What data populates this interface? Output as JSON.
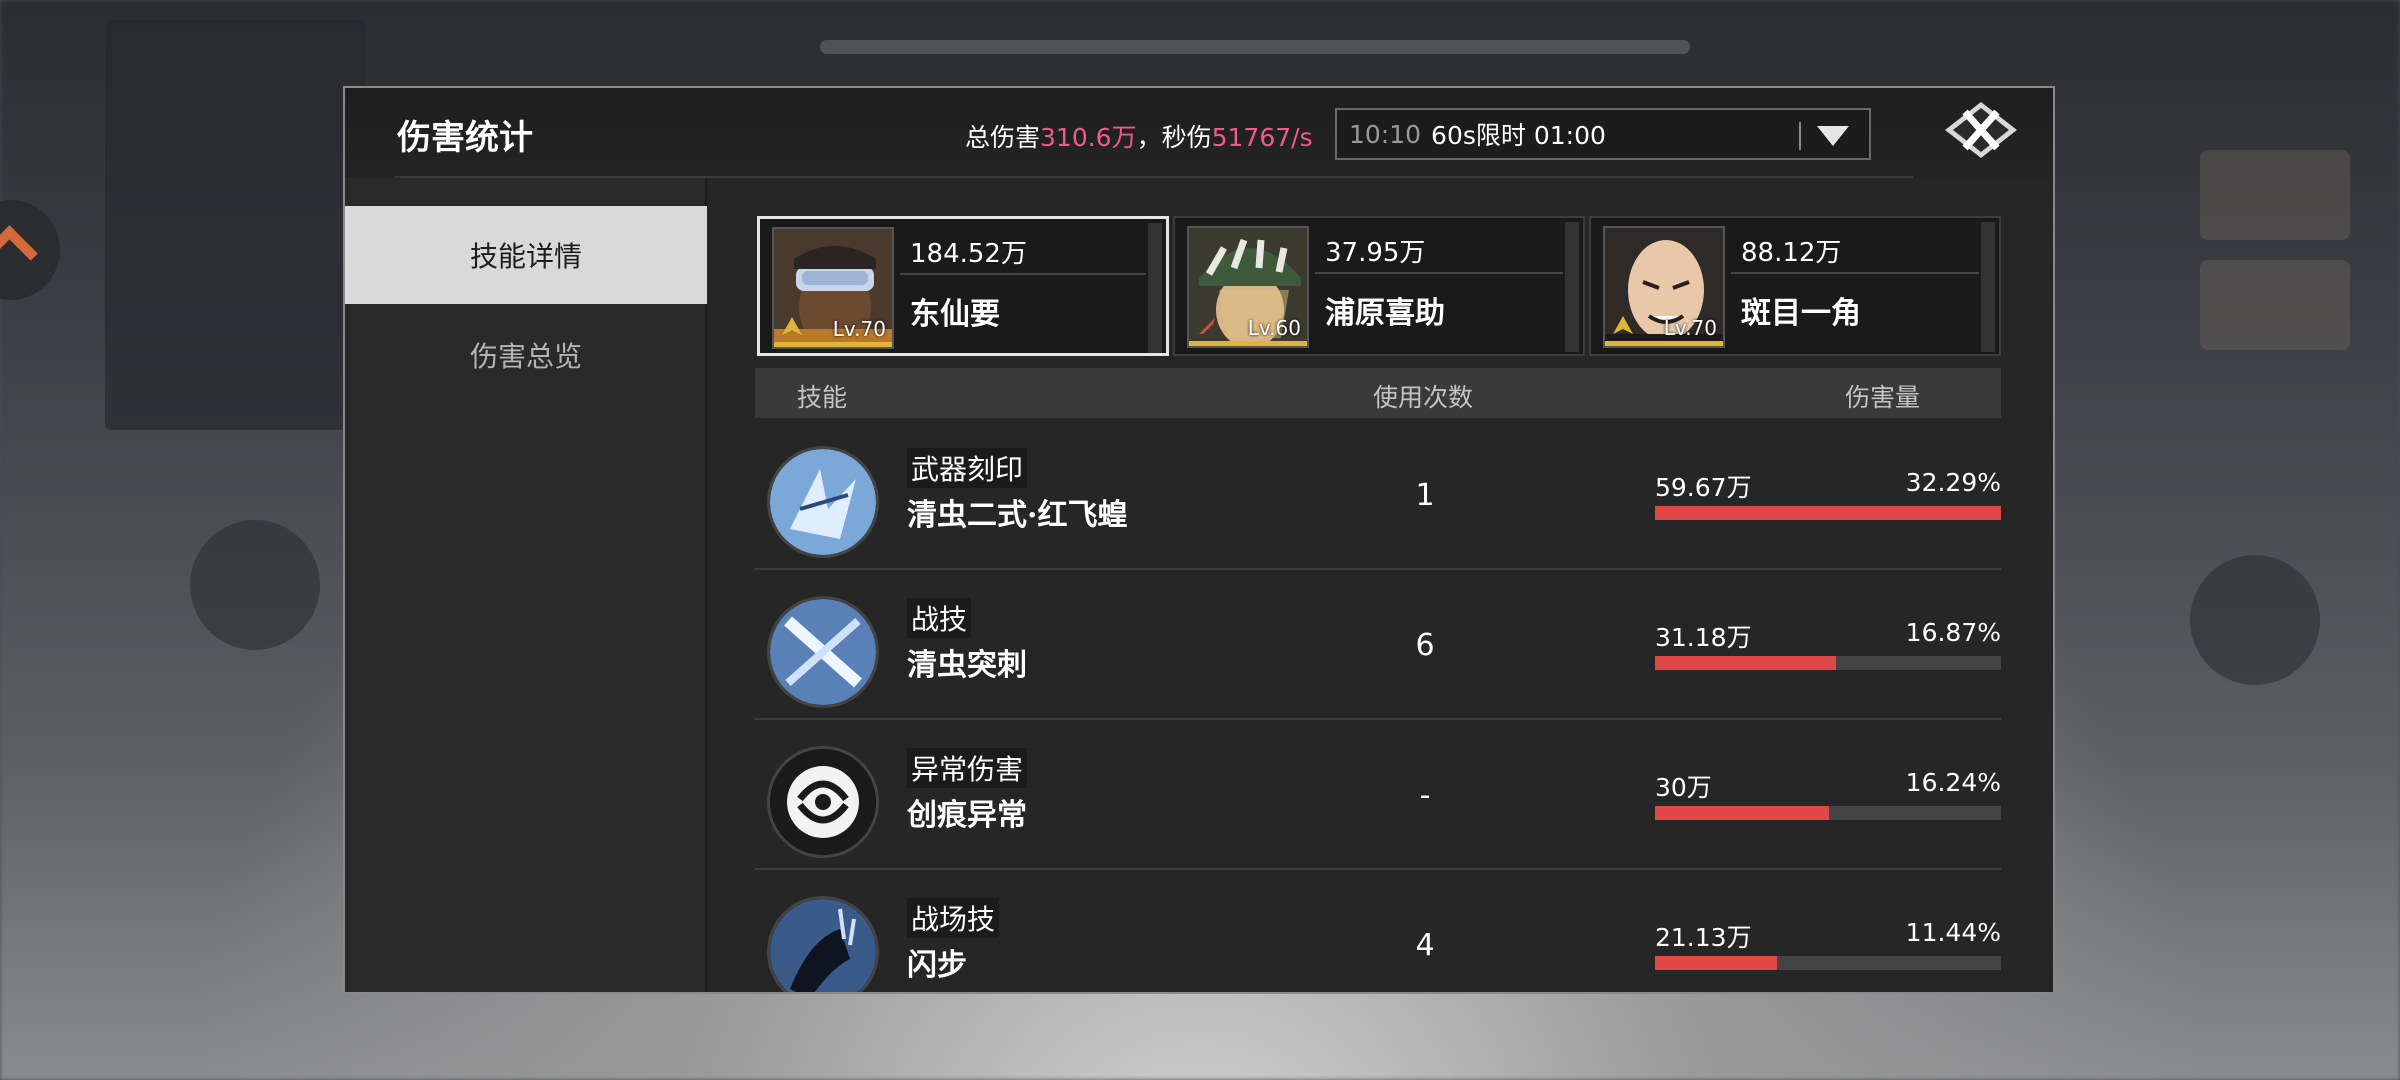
{
  "dialog": {
    "title": "伤害统计",
    "summary": {
      "total_label": "总伤害",
      "total_value": "310.6万",
      "separator": "，",
      "dps_label": "秒伤",
      "dps_value": "51767/s"
    },
    "time_select": {
      "time": "10:10",
      "mode": "60s限时 01:00"
    },
    "colors": {
      "accent_pink": "#ef5a8a",
      "bar_red": "#e04848",
      "active_tab": "#d9d9d9"
    }
  },
  "sidebar": {
    "tabs": [
      {
        "label": "技能详情",
        "active": true
      },
      {
        "label": "伤害总览",
        "active": false
      }
    ]
  },
  "characters": [
    {
      "damage": "184.52万",
      "name": "东仙要",
      "level": "Lv.70",
      "active": true
    },
    {
      "damage": "37.95万",
      "name": "浦原喜助",
      "level": "Lv.60",
      "active": false
    },
    {
      "damage": "88.12万",
      "name": "斑目一角",
      "level": "Lv.70",
      "active": false
    }
  ],
  "table": {
    "headers": {
      "skill": "技能",
      "uses": "使用次数",
      "damage": "伤害量"
    },
    "rows": [
      {
        "type": "武器刻印",
        "name": "清虫二式·红飞蝗",
        "uses": "1",
        "damage": "59.67万",
        "percent": "32.29%",
        "fraction": 1.0,
        "icon": "ice-shard-icon"
      },
      {
        "type": "战技",
        "name": "清虫突刺",
        "uses": "6",
        "damage": "31.18万",
        "percent": "16.87%",
        "fraction": 0.522,
        "icon": "cross-slash-icon"
      },
      {
        "type": "异常伤害",
        "name": "创痕异常",
        "uses": "-",
        "damage": "30万",
        "percent": "16.24%",
        "fraction": 0.503,
        "icon": "swirl-icon"
      },
      {
        "type": "战场技",
        "name": "闪步",
        "uses": "4",
        "damage": "21.13万",
        "percent": "11.44%",
        "fraction": 0.354,
        "icon": "dash-silhouette-icon"
      }
    ]
  }
}
